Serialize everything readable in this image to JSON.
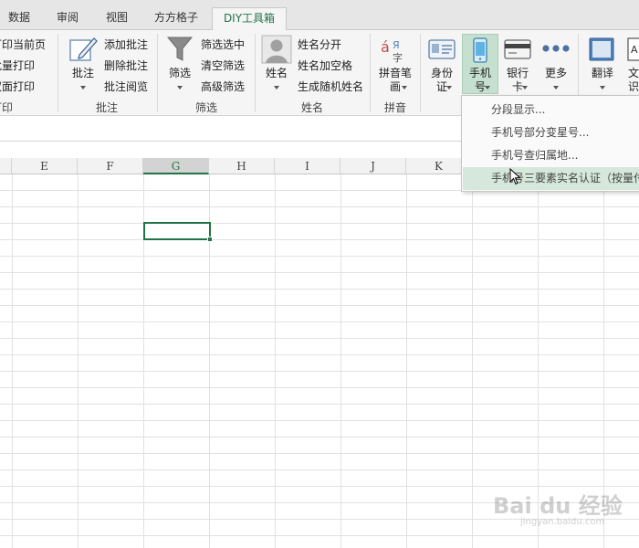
{
  "tabs": [
    {
      "label": "数据"
    },
    {
      "label": "审阅"
    },
    {
      "label": "视图"
    },
    {
      "label": "方方格子"
    },
    {
      "label": "DIY工具箱"
    }
  ],
  "ribbon": {
    "print_group": {
      "items": [
        "打印当前页",
        "批量打印",
        "双面打印"
      ],
      "label": "打印"
    },
    "comment_group": {
      "big_button": "批注",
      "items": [
        "添加批注",
        "删除批注",
        "批注阅览"
      ],
      "label": "批注"
    },
    "filter_group": {
      "big_button": "筛选",
      "items": [
        "筛选选中",
        "清空筛选",
        "高级筛选"
      ],
      "label": "筛选"
    },
    "name_group": {
      "big_button": "姓名",
      "items": [
        "姓名分开",
        "姓名加空格",
        "生成随机姓名"
      ],
      "label": "姓名"
    },
    "pinyin_group": {
      "big_button_line1": "拼音笔",
      "big_button_line2": "画",
      "label": "拼音"
    },
    "id_button": {
      "line1": "身份",
      "line2": "证"
    },
    "phone_button": {
      "line1": "手机",
      "line2": "号"
    },
    "bank_button": {
      "line1": "银行",
      "line2": "卡"
    },
    "more_button": {
      "line1": "更多"
    },
    "translate_button": {
      "line1": "翻译"
    },
    "text_button": {
      "line1": "文",
      "line2": "识"
    }
  },
  "columns": [
    "E",
    "F",
    "G",
    "H",
    "I",
    "J",
    "K"
  ],
  "selected_column": "G",
  "dropdown": {
    "items": [
      {
        "label": "分段显示..."
      },
      {
        "label": "手机号部分变星号..."
      },
      {
        "label": "手机号查归属地..."
      },
      {
        "label": "手机号三要素实名认证（按量付费）..."
      }
    ]
  },
  "watermark": {
    "main": "Bai du 经验",
    "sub": "jingyan.baidu.com"
  },
  "colors": {
    "accent": "#217346",
    "hover": "#d5e8db"
  }
}
